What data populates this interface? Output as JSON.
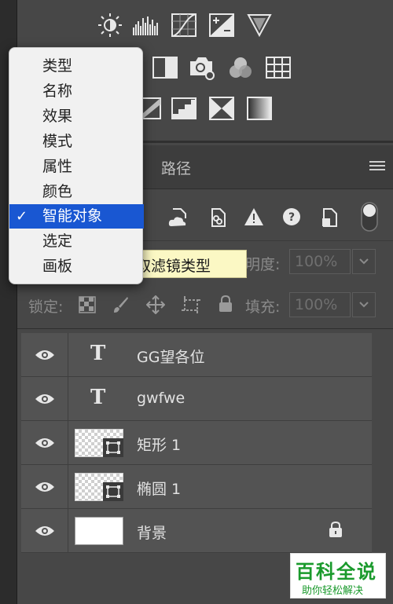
{
  "colors": {
    "panel_bg": "#474747",
    "layer_row_bg": "#535353",
    "menu_bg": "#f1f1f1",
    "menu_selected": "#1957d2",
    "tooltip_bg": "#fbf8c4",
    "watermark_green": "#1a9a2c"
  },
  "adjustments": {
    "icons": [
      "brightness-contrast-icon",
      "levels-icon",
      "curves-icon",
      "exposure-icon",
      "vibrance-icon",
      "hue-saturation-icon",
      "color-balance-icon",
      "black-white-icon",
      "photo-filter-icon",
      "channel-mixer-icon",
      "color-lookup-icon",
      "invert-icon",
      "posterize-icon",
      "threshold-icon",
      "selective-color-icon",
      "gradient-map-icon"
    ]
  },
  "tabs": {
    "paths": "路径",
    "menu_icon": "hamburger-icon"
  },
  "filter_kind_menu": {
    "items": [
      {
        "label": "类型",
        "selected": false
      },
      {
        "label": "名称",
        "selected": false
      },
      {
        "label": "效果",
        "selected": false
      },
      {
        "label": "模式",
        "selected": false
      },
      {
        "label": "属性",
        "selected": false
      },
      {
        "label": "颜色",
        "selected": false
      },
      {
        "label": "智能对象",
        "selected": true
      },
      {
        "label": "选定",
        "selected": false
      },
      {
        "label": "画板",
        "selected": false
      }
    ],
    "checkmark": "✓"
  },
  "tooltip": {
    "text": "取滤镜类型"
  },
  "filter_icons": [
    "cloud-linked-icon",
    "linked-file-icon",
    "warning-icon",
    "missing-help-icon",
    "embedded-file-icon",
    "filter-toggle"
  ],
  "opacity": {
    "label_tail": "明度:",
    "value": "100%"
  },
  "lock": {
    "label": "锁定:",
    "fill_label": "填充:",
    "fill_value": "100%"
  },
  "layers": [
    {
      "name": "GG望各位",
      "kind": "text",
      "visible": true
    },
    {
      "name": "gwfwe",
      "kind": "text",
      "visible": true
    },
    {
      "name": "矩形 1",
      "kind": "smart",
      "visible": true
    },
    {
      "name": "椭圆 1",
      "kind": "smart",
      "visible": true
    },
    {
      "name": "背景",
      "kind": "background",
      "visible": true,
      "locked": true
    }
  ],
  "type_glyph": "T",
  "watermark": {
    "title": "百科全说",
    "subtitle": "助你轻松解决"
  }
}
